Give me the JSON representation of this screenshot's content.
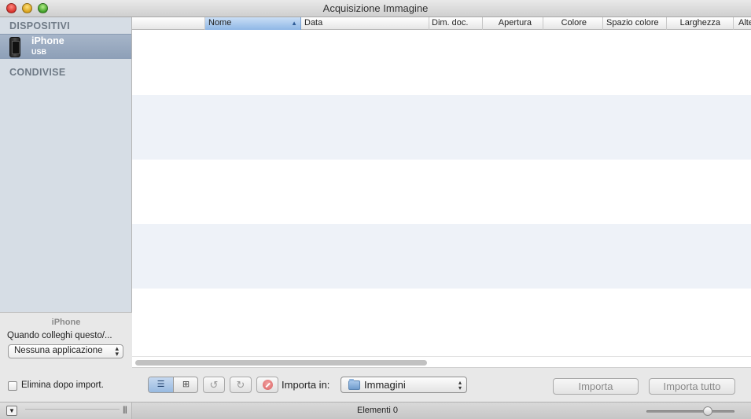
{
  "window": {
    "title": "Acquisizione Immagine"
  },
  "sidebar": {
    "devices_heading": "DISPOSITIVI",
    "device": {
      "name": "iPhone",
      "connection": "USB"
    },
    "shared_heading": "CONDIVISE",
    "panel": {
      "device_title": "iPhone",
      "connect_label": "Quando colleghi questo/...",
      "app_select_value": "Nessuna applicazione",
      "delete_after_import_label": "Elimina dopo import.",
      "delete_after_import_checked": false
    }
  },
  "table": {
    "columns": [
      "Nome",
      "Data",
      "Dim. doc.",
      "Apertura",
      "Colore",
      "Spazio colore",
      "Larghezza",
      "Alte"
    ],
    "sorted_column": "Nome",
    "rows": []
  },
  "toolbar": {
    "view_list_icon": "list-view-icon",
    "view_grid_icon": "grid-view-icon",
    "rotate_left_icon": "rotate-left-icon",
    "rotate_right_icon": "rotate-right-icon",
    "delete_icon": "delete-icon",
    "import_in_label": "Importa in:",
    "destination": "Immagini",
    "import_button": "Importa",
    "import_all_button": "Importa tutto"
  },
  "status": {
    "items_count_text": "Elementi 0",
    "zoom_level": 0.72
  }
}
